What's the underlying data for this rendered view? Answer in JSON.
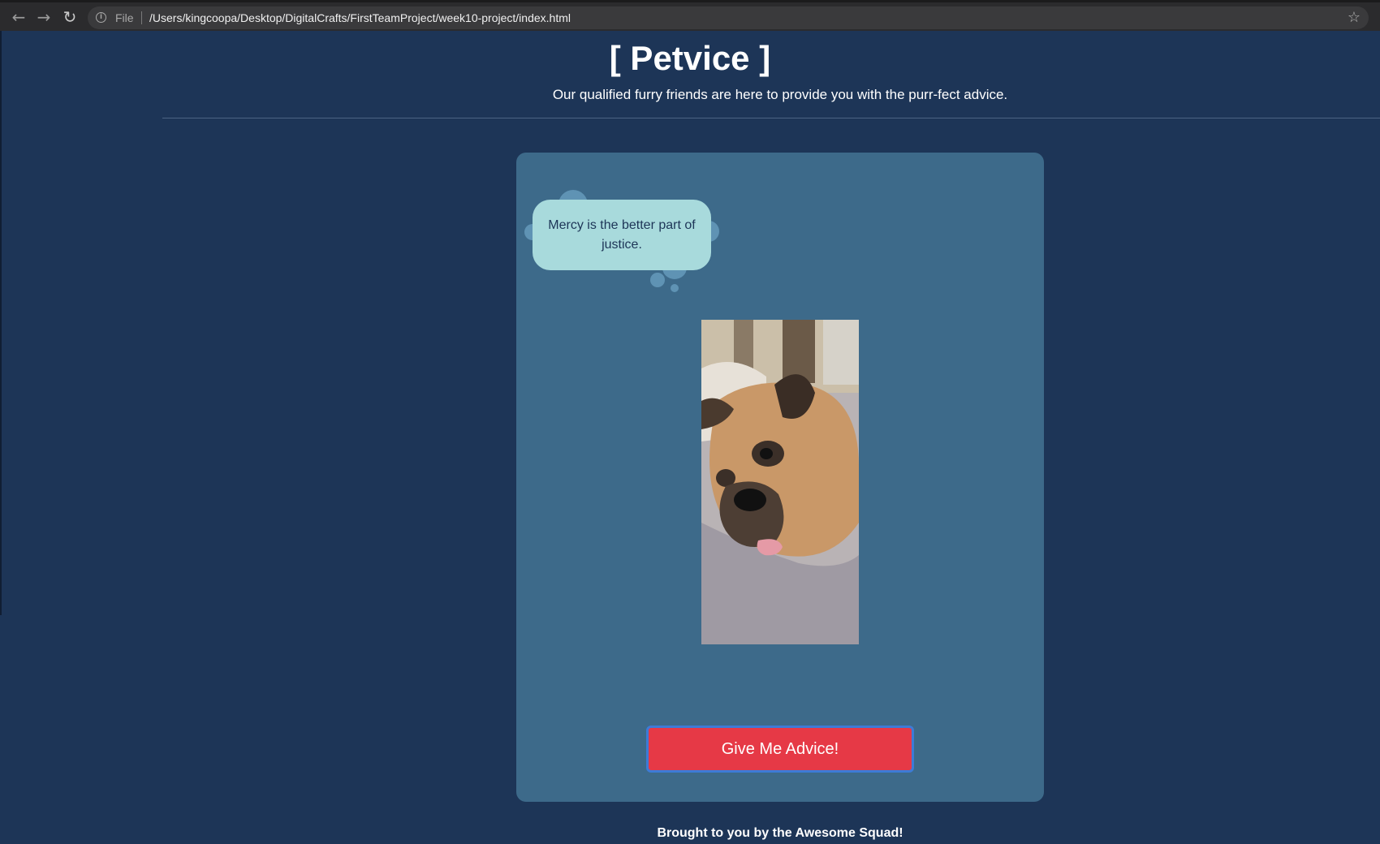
{
  "browser": {
    "back_icon": "arrow-left-icon",
    "forward_icon": "arrow-right-icon",
    "reload_icon": "reload-icon",
    "info_icon": "info-icon",
    "scheme": "File",
    "url": "/Users/kingcoopa/Desktop/DigitalCrafts/FirstTeamProject/week10-project/index.html",
    "bookmark_icon": "star-icon"
  },
  "header": {
    "title": "[ Petvice ]",
    "subtitle": "Our qualified furry friends are here to provide you with the purr-fect advice."
  },
  "card": {
    "advice": "Mercy is the better part of justice.",
    "photo": "dog-photo",
    "button_label": "Give Me Advice!"
  },
  "footer": {
    "text": "Brought to you by the Awesome Squad!"
  },
  "colors": {
    "page_bg": "#1d3557",
    "card_bg": "#3d6a8a",
    "bubble_bg": "#a8dadc",
    "button_bg": "#e63946",
    "button_border": "#3d7bd6"
  }
}
